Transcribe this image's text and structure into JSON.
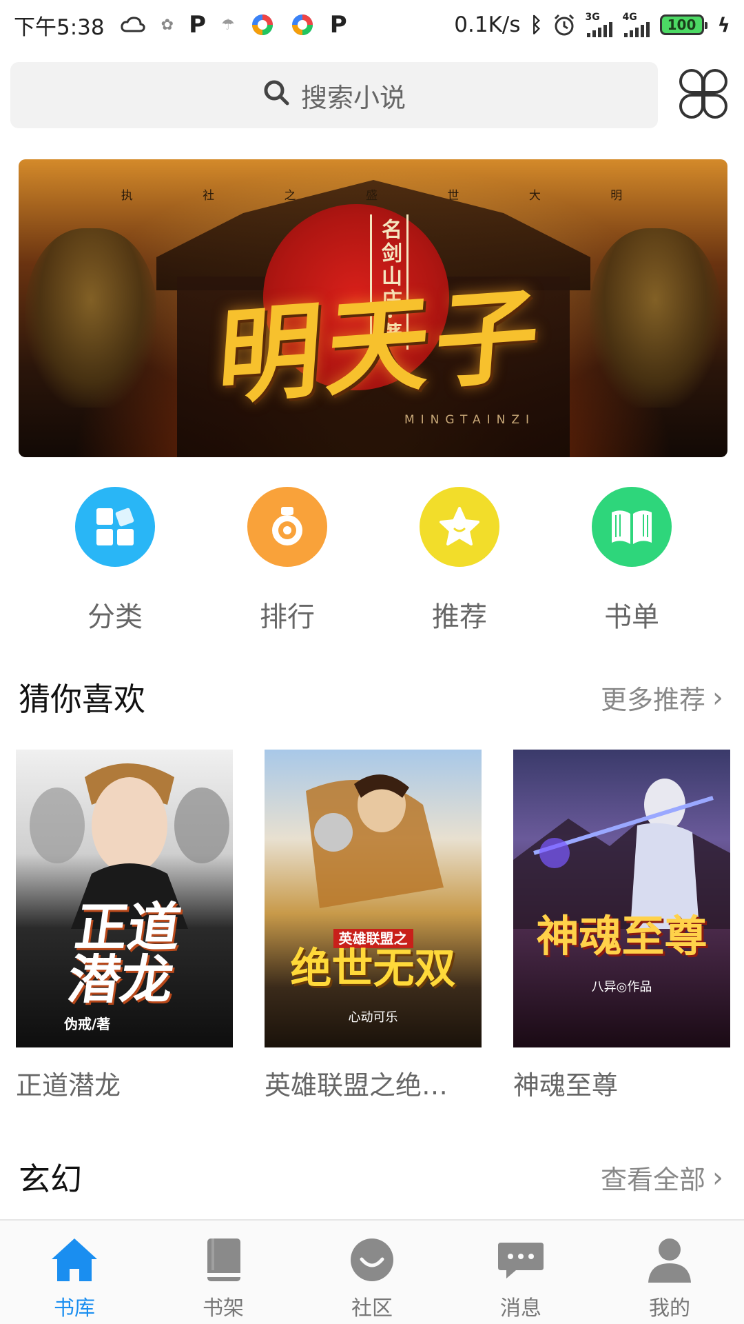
{
  "status_bar": {
    "time": "下午5:38",
    "net_speed": "0.1K/s",
    "signal_1": "3G",
    "signal_2": "4G",
    "battery": "100",
    "icons": [
      "cloud-icon",
      "baidu-icon",
      "p-icon",
      "weather-icon",
      "browser-icon",
      "browser-icon",
      "p-icon",
      "bluetooth-icon",
      "alarm-icon",
      "signal-icon",
      "signal-icon",
      "battery-icon",
      "charging-icon"
    ]
  },
  "search": {
    "placeholder": "搜索小说"
  },
  "banner": {
    "top_text": [
      "执",
      "社",
      "之",
      "盛",
      "世",
      "大",
      "明"
    ],
    "author": "名剑山庄·著",
    "title": "明天子",
    "subtitle": "MINGTAINZI"
  },
  "categories": [
    {
      "label": "分类",
      "icon": "category-icon",
      "color": "#29b6f6"
    },
    {
      "label": "排行",
      "icon": "ranking-icon",
      "color": "#f9a23a"
    },
    {
      "label": "推荐",
      "icon": "star-icon",
      "color": "#f2dd2a"
    },
    {
      "label": "书单",
      "icon": "booklist-icon",
      "color": "#2ed67b"
    }
  ],
  "guess": {
    "title": "猜你喜欢",
    "more": "更多推荐"
  },
  "books": [
    {
      "name": "正道潜龙",
      "cover_text": "正道\n潜龙",
      "cover_author": "伪戒/著"
    },
    {
      "name": "英雄联盟之绝…",
      "cover_text": "绝世无双",
      "cover_tag": "英雄联盟之",
      "cover_author": "心动可乐"
    },
    {
      "name": "神魂至尊",
      "cover_text": "神魂至尊",
      "cover_author": "八异◎作品"
    }
  ],
  "section2": {
    "title": "玄幻",
    "more": "查看全部"
  },
  "tabs": [
    {
      "label": "书库",
      "icon": "home-icon",
      "active": true
    },
    {
      "label": "书架",
      "icon": "bookshelf-icon",
      "active": false
    },
    {
      "label": "社区",
      "icon": "community-icon",
      "active": false
    },
    {
      "label": "消息",
      "icon": "message-icon",
      "active": false
    },
    {
      "label": "我的",
      "icon": "profile-icon",
      "active": false
    }
  ],
  "colors": {
    "accent": "#1a8ef0",
    "inactive_icon": "#8a8a8a"
  }
}
